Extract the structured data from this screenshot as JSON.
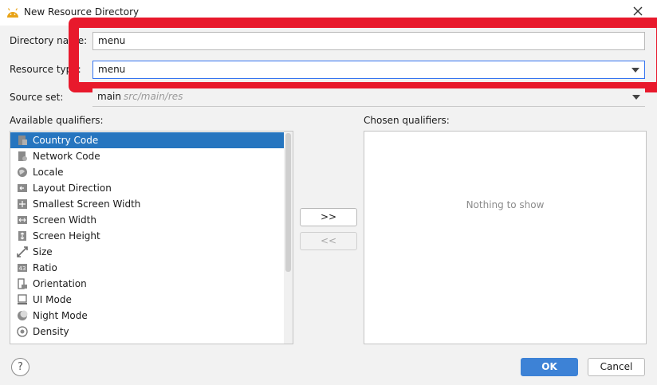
{
  "window": {
    "title": "New Resource Directory"
  },
  "form": {
    "directory_name_label": "Directory name:",
    "directory_name_value": "menu",
    "resource_type_label": "Resource type:",
    "resource_type_value": "menu",
    "source_set_label": "Source set:",
    "source_set_value": "main",
    "source_set_path": "src/main/res"
  },
  "qualifiers": {
    "available_label": "Available qualifiers:",
    "chosen_label": "Chosen qualifiers:",
    "empty_text": "Nothing to show",
    "selected_index": 0,
    "items": [
      {
        "label": "Country Code",
        "icon": "country-code-icon"
      },
      {
        "label": "Network Code",
        "icon": "network-code-icon"
      },
      {
        "label": "Locale",
        "icon": "globe-icon"
      },
      {
        "label": "Layout Direction",
        "icon": "layout-direction-icon"
      },
      {
        "label": "Smallest Screen Width",
        "icon": "smallest-width-icon"
      },
      {
        "label": "Screen Width",
        "icon": "screen-width-icon"
      },
      {
        "label": "Screen Height",
        "icon": "screen-height-icon"
      },
      {
        "label": "Size",
        "icon": "size-icon"
      },
      {
        "label": "Ratio",
        "icon": "ratio-icon"
      },
      {
        "label": "Orientation",
        "icon": "orientation-icon"
      },
      {
        "label": "UI Mode",
        "icon": "ui-mode-icon"
      },
      {
        "label": "Night Mode",
        "icon": "night-mode-icon"
      },
      {
        "label": "Density",
        "icon": "density-icon"
      }
    ]
  },
  "buttons": {
    "add_label": ">>",
    "remove_label": "<<",
    "ok_label": "OK",
    "cancel_label": "Cancel",
    "help_label": "?"
  },
  "colors": {
    "selection": "#2675bf",
    "primary_button": "#3d82d6",
    "highlight_annotation": "#e8192c",
    "focus_border": "#3574f0"
  }
}
